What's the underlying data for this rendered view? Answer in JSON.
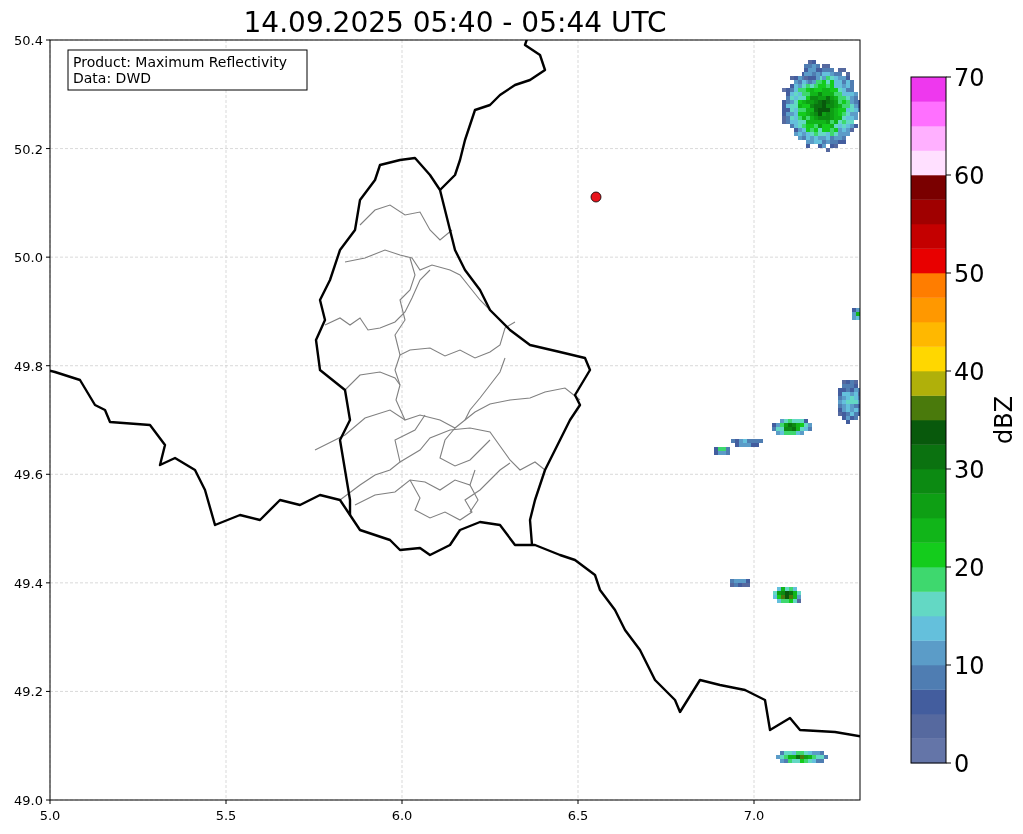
{
  "title": "14.09.2025 05:40 - 05:44 UTC",
  "legend": {
    "lines": [
      "Product: Maximum Reflectivity",
      "Data: DWD"
    ]
  },
  "x_axis": {
    "ticks": [
      "5.0",
      "5.5",
      "6.0",
      "6.5",
      "7.0"
    ]
  },
  "y_axis": {
    "ticks": [
      "50.4",
      "50.2",
      "50.0",
      "49.8",
      "49.6",
      "49.4",
      "49.2",
      "49.0"
    ]
  },
  "colorbar": {
    "label": "dBZ",
    "ticks": [
      "70",
      "60",
      "50",
      "40",
      "30",
      "20",
      "10",
      "0"
    ],
    "bands": [
      {
        "color": "#6475a8"
      },
      {
        "color": "#56699f"
      },
      {
        "color": "#435d9e"
      },
      {
        "color": "#4f7db2"
      },
      {
        "color": "#5b9cc8"
      },
      {
        "color": "#64c0dc"
      },
      {
        "color": "#63d8c4"
      },
      {
        "color": "#3ed86e"
      },
      {
        "color": "#14cc1c"
      },
      {
        "color": "#11b519"
      },
      {
        "color": "#0e9f14"
      },
      {
        "color": "#0c8a12"
      },
      {
        "color": "#0b7210"
      },
      {
        "color": "#08590c"
      },
      {
        "color": "#4a7a0c"
      },
      {
        "color": "#b0b00a"
      },
      {
        "color": "#ffd700"
      },
      {
        "color": "#ffb800"
      },
      {
        "color": "#ff9800"
      },
      {
        "color": "#ff7d00"
      },
      {
        "color": "#e80000"
      },
      {
        "color": "#c40000"
      },
      {
        "color": "#a00000"
      },
      {
        "color": "#7a0000"
      },
      {
        "color": "#ffe0ff"
      },
      {
        "color": "#ffb0ff"
      },
      {
        "color": "#ff70ff"
      },
      {
        "color": "#ee38ee"
      }
    ]
  }
}
